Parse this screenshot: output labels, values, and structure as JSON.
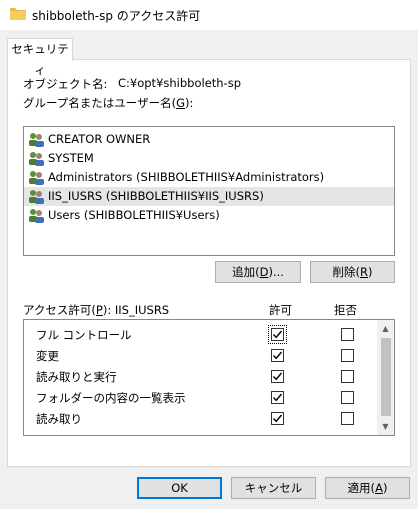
{
  "window": {
    "title": "shibboleth-sp のアクセス許可",
    "icon": "folder-icon"
  },
  "tabs": [
    {
      "label": "セキュリティ",
      "active": true
    }
  ],
  "object": {
    "label": "オブジェクト名:",
    "value": "C:¥opt¥shibboleth-sp"
  },
  "groups": {
    "label_prefix": "グループ名またはユーザー名(",
    "label_key": "G",
    "label_suffix": "):",
    "items": [
      {
        "name": "CREATOR OWNER",
        "icon": "users-icon",
        "selected": false
      },
      {
        "name": "SYSTEM",
        "icon": "users-icon",
        "selected": false
      },
      {
        "name": "Administrators (SHIBBOLETHIIS¥Administrators)",
        "icon": "users-icon",
        "selected": false
      },
      {
        "name": "IIS_IUSRS (SHIBBOLETHIIS¥IIS_IUSRS)",
        "icon": "users-icon",
        "selected": true
      },
      {
        "name": "Users (SHIBBOLETHIIS¥Users)",
        "icon": "users-icon",
        "selected": false
      }
    ]
  },
  "group_buttons": {
    "add": {
      "prefix": "追加(",
      "key": "D",
      "suffix": ")..."
    },
    "remove": {
      "prefix": "削除(",
      "key": "R",
      "suffix": ")"
    }
  },
  "permissions": {
    "label_prefix": "アクセス許可(",
    "label_key": "P",
    "label_suffix": "): IIS_IUSRS",
    "allow_header": "許可",
    "deny_header": "拒否",
    "rows": [
      {
        "name": "フル コントロール",
        "allow": true,
        "deny": false,
        "focused": true
      },
      {
        "name": "変更",
        "allow": true,
        "deny": false
      },
      {
        "name": "読み取りと実行",
        "allow": true,
        "deny": false
      },
      {
        "name": "フォルダーの内容の一覧表示",
        "allow": true,
        "deny": false
      },
      {
        "name": "読み取り",
        "allow": true,
        "deny": false
      }
    ]
  },
  "footer": {
    "ok": "OK",
    "cancel": "キャンセル",
    "apply": {
      "prefix": "適用(",
      "key": "A",
      "suffix": ")"
    }
  },
  "colors": {
    "accent": "#0078d7",
    "selection": "#e5e5e5",
    "window_bg": "#f0f0f0"
  }
}
